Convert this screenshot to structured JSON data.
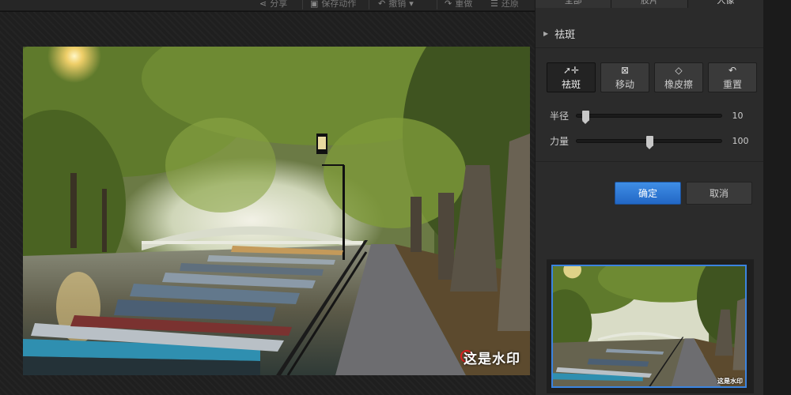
{
  "toolbar": {
    "share_label": "分享",
    "save_label": "保存动作",
    "undo_label": "撤销",
    "redo_label": "重做",
    "restore_label": "还原"
  },
  "panel": {
    "tabs": [
      "全部",
      "胶片",
      "人像"
    ],
    "active_tab": 2,
    "section_title": "祛斑",
    "tools": [
      {
        "label": "祛斑",
        "icon": "cursor-plus-icon",
        "active": true
      },
      {
        "label": "移动",
        "icon": "move-icon",
        "active": false
      },
      {
        "label": "橡皮擦",
        "icon": "eraser-icon",
        "active": false
      },
      {
        "label": "重置",
        "icon": "reset-icon",
        "active": false
      }
    ],
    "sliders": {
      "radius": {
        "label": "半径",
        "value": "10",
        "fraction": 0.06
      },
      "strength": {
        "label": "力量",
        "value": "100",
        "fraction": 0.5
      }
    },
    "ok_label": "确定",
    "cancel_label": "取消"
  },
  "canvas": {
    "watermark": "这是水印"
  },
  "colors": {
    "accent": "#2f7fdc",
    "cursor": "#e02020"
  }
}
